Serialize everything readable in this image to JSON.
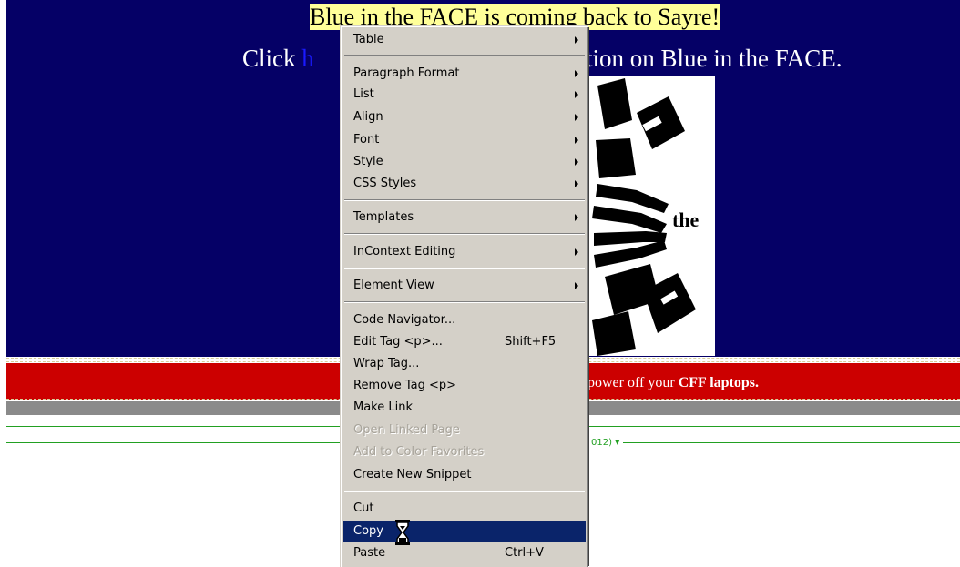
{
  "page": {
    "headline": "Blue in the FACE is coming back to Sayre!",
    "subline_start": "Click ",
    "subline_link_fragment": "h",
    "subline_end": "tion on Blue in the FACE.",
    "logo_text": "the",
    "red_band_text": "power off your ",
    "red_band_bold": "CFF laptops.",
    "tag_label": "012)",
    "colors": {
      "blue_band": "#050066",
      "headline_highlight": "#ffff99",
      "red_band": "#cc0000",
      "gray_band": "#8a8a8a",
      "green_rule": "#22a022"
    }
  },
  "context_menu": {
    "items": [
      {
        "label": "Table",
        "submenu": true
      },
      {
        "label": "Paragraph Format",
        "submenu": true
      },
      {
        "label": "List",
        "submenu": true
      },
      {
        "label": "Align",
        "submenu": true
      },
      {
        "label": "Font",
        "submenu": true
      },
      {
        "label": "Style",
        "submenu": true
      },
      {
        "label": "CSS Styles",
        "submenu": true
      },
      {
        "label": "Templates",
        "submenu": true
      },
      {
        "label": "InContext Editing",
        "submenu": true
      },
      {
        "label": "Element View",
        "submenu": true
      },
      {
        "label": "Code Navigator..."
      },
      {
        "label": "Edit Tag <p>...",
        "shortcut": "Shift+F5"
      },
      {
        "label": "Wrap Tag..."
      },
      {
        "label": "Remove Tag <p>"
      },
      {
        "label": "Make Link"
      },
      {
        "label": "Open Linked Page",
        "disabled": true
      },
      {
        "label": "Add to Color Favorites",
        "disabled": true
      },
      {
        "label": "Create New Snippet"
      },
      {
        "label": "Cut"
      },
      {
        "label": "Copy",
        "highlighted": true
      },
      {
        "label": "Paste",
        "shortcut": "Ctrl+V"
      }
    ],
    "colors": {
      "background": "#d4d0c8",
      "highlight": "#0a246a"
    }
  },
  "cursor": {
    "icon": "hourglass-icon"
  }
}
